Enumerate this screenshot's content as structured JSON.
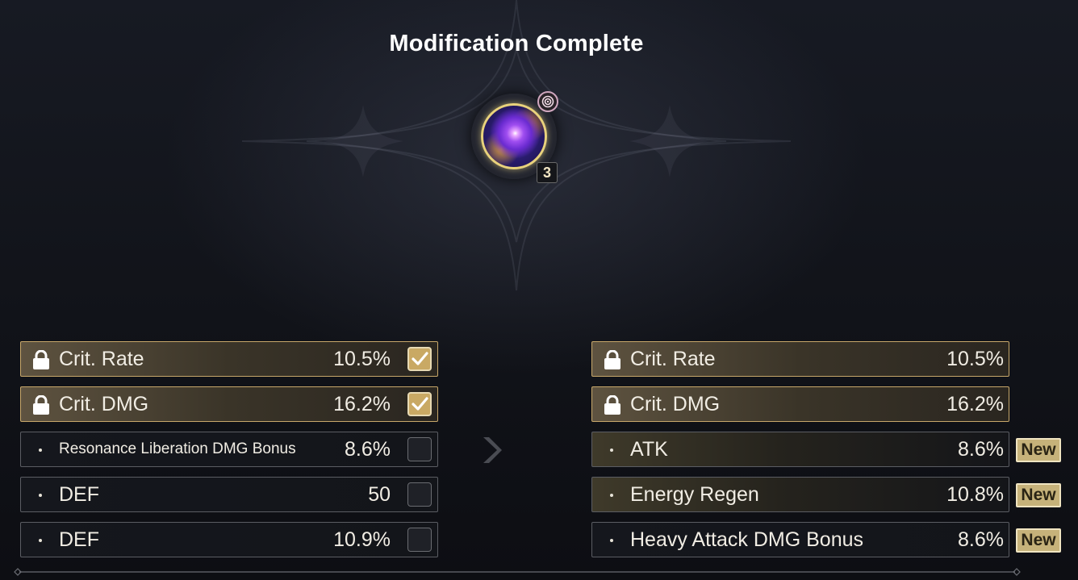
{
  "title": "Modification Complete",
  "echo": {
    "level": "3",
    "icon": "purple-flower-echo",
    "sonata_icon": "swirl-sonata-icon",
    "frame_color": "#e9d27c"
  },
  "left_stats": [
    {
      "name": "Crit. Rate",
      "value": "10.5%",
      "locked": true,
      "checked": true
    },
    {
      "name": "Crit. DMG",
      "value": "16.2%",
      "locked": true,
      "checked": true
    },
    {
      "name": "Resonance Liberation DMG Bonus",
      "value": "8.6%",
      "locked": false,
      "checked": false
    },
    {
      "name": "DEF",
      "value": "50",
      "locked": false,
      "checked": false
    },
    {
      "name": "DEF",
      "value": "10.9%",
      "locked": false,
      "checked": false
    }
  ],
  "right_stats": [
    {
      "name": "Crit. Rate",
      "value": "10.5%",
      "locked": true,
      "badge": ""
    },
    {
      "name": "Crit. DMG",
      "value": "16.2%",
      "locked": true,
      "badge": ""
    },
    {
      "name": "ATK",
      "value": "8.6%",
      "locked": false,
      "badge": "New"
    },
    {
      "name": "Energy Regen",
      "value": "10.8%",
      "locked": false,
      "badge": "New"
    },
    {
      "name": "Heavy Attack DMG Bonus",
      "value": "8.6%",
      "locked": false,
      "badge": "New"
    }
  ],
  "colors": {
    "locked_border": "#c7a76a",
    "checkbox_checked": "#c9a964",
    "new_badge": "#c6b27a"
  }
}
